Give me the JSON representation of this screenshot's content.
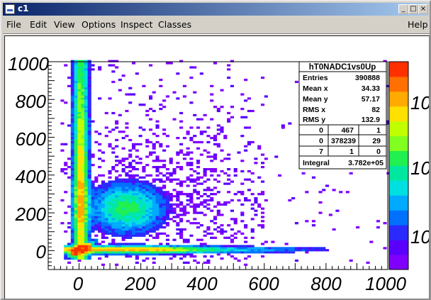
{
  "window": {
    "title": "c1",
    "buttons": {
      "minimize": "_",
      "maximize": "□",
      "close": "×"
    }
  },
  "menu": {
    "items": [
      "File",
      "Edit",
      "View",
      "Options",
      "Inspect",
      "Classes"
    ],
    "help": "Help"
  },
  "stats": {
    "title": "hT0NADC1vs0Up",
    "rows": [
      {
        "label": "Entries",
        "value": "390888"
      },
      {
        "label": "Mean x",
        "value": "34.33"
      },
      {
        "label": "Mean y",
        "value": "57.17"
      },
      {
        "label": "RMS x",
        "value": "82"
      },
      {
        "label": "RMS y",
        "value": "132.9"
      }
    ],
    "grid": [
      [
        "0",
        "467",
        "1"
      ],
      [
        "0",
        "378239",
        "29"
      ],
      [
        "7",
        "1",
        "0"
      ]
    ],
    "integral_label": "Integral",
    "integral_value": "3.782e+05"
  },
  "chart_data": {
    "type": "heatmap",
    "title": "",
    "xlabel": "",
    "ylabel": "",
    "xlim": [
      -100,
      1000
    ],
    "ylim": [
      -100,
      1000
    ],
    "x_ticks": [
      "0",
      "200",
      "400",
      "600",
      "800",
      "1000"
    ],
    "y_ticks": [
      "0",
      "200",
      "400",
      "600",
      "800",
      "1000"
    ],
    "colorbar_ticks": [
      "10",
      "10",
      "10"
    ],
    "palette": [
      "#7f00ff",
      "#5a00ff",
      "#2a2aff",
      "#0070ff",
      "#00aaff",
      "#00e0e0",
      "#00e8a0",
      "#20f050",
      "#80ff20",
      "#c0ff00",
      "#ffe000",
      "#ffaa00",
      "#ff7000",
      "#ff3000"
    ],
    "components": [
      {
        "name": "vertical-band",
        "x": 0,
        "y_from": -50,
        "y_to": 1000
      },
      {
        "name": "horizontal-band",
        "y": 0,
        "x_from": -50,
        "x_to": 800
      },
      {
        "name": "central-blob",
        "x": 150,
        "y": 220
      },
      {
        "name": "hot-spot",
        "x": 0,
        "y": 0
      }
    ]
  }
}
